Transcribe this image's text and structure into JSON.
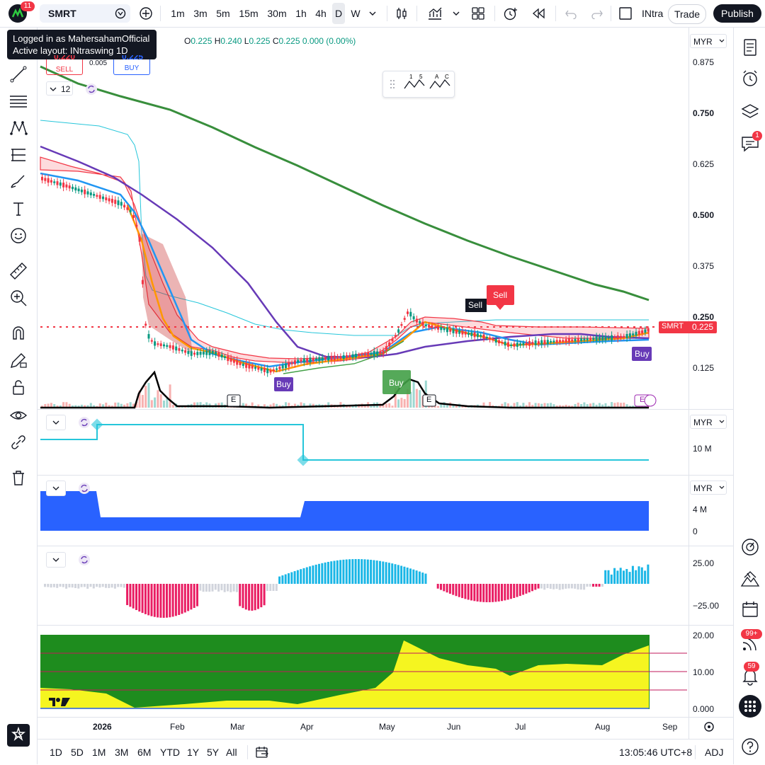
{
  "topbar": {
    "notification_count": "11",
    "symbol": "SMRT",
    "intervals": [
      "1m",
      "3m",
      "5m",
      "15m",
      "30m",
      "1h",
      "4h",
      "D",
      "W"
    ],
    "layout_name": "INtra",
    "trade_label": "Trade",
    "publish_label": "Publish"
  },
  "tooltip": {
    "line1": "Logged in as MahersahamOfficial",
    "line2": "Active layout: INtraswing 1D"
  },
  "legend": {
    "ohlc_o_label": "O",
    "ohlc_o": "0.225",
    "ohlc_h_label": "H",
    "ohlc_h": "0.240",
    "ohlc_l_label": "L",
    "ohlc_l": "0.225",
    "ohlc_c_label": "C",
    "ohlc_c": "0.225",
    "change": "0.000 (0.00%)",
    "sell_price": "0.220",
    "sell_label": "SELL",
    "spread": "0.005",
    "buy_price": "0.225",
    "buy_label": "BUY",
    "indicator_count": "12"
  },
  "price_axis": {
    "currency": "MYR",
    "ticks": [
      "0.875",
      "0.750",
      "0.625",
      "0.500",
      "0.375",
      "0.250",
      "0.125"
    ],
    "last_symbol": "SMRT",
    "last_price": "0.225"
  },
  "signals": {
    "sell1": "Sell",
    "sell2": "Sell",
    "buy1": "Buy",
    "buy2": "Buy",
    "buy3": "Buy",
    "earnings": "E"
  },
  "pane2": {
    "currency": "MYR",
    "tick": "10 M"
  },
  "pane3": {
    "currency": "MYR",
    "ticks": [
      "4 M",
      "0"
    ]
  },
  "pane4": {
    "ticks": [
      "25.00",
      "−25.00"
    ]
  },
  "pane5": {
    "ticks": [
      "20.00",
      "10.00",
      "0.000"
    ]
  },
  "time_axis": {
    "labels": [
      "2026",
      "Feb",
      "Mar",
      "Apr",
      "May",
      "Jun",
      "Jul",
      "Aug",
      "Sep"
    ]
  },
  "bottombar": {
    "ranges": [
      "1D",
      "5D",
      "1M",
      "3M",
      "6M",
      "YTD",
      "1Y",
      "5Y",
      "All"
    ],
    "clock": "13:05:46 UTC+8",
    "adj": "ADJ"
  },
  "rightbar": {
    "chat_badge": "1",
    "badge_99": "99+",
    "badge_59": "59"
  },
  "colors": {
    "accent": "#2962ff",
    "buy": "#2962ff",
    "sell": "#f23645",
    "green": "#388e3c",
    "purple": "#673ab7",
    "cyan": "#26c6da"
  }
}
